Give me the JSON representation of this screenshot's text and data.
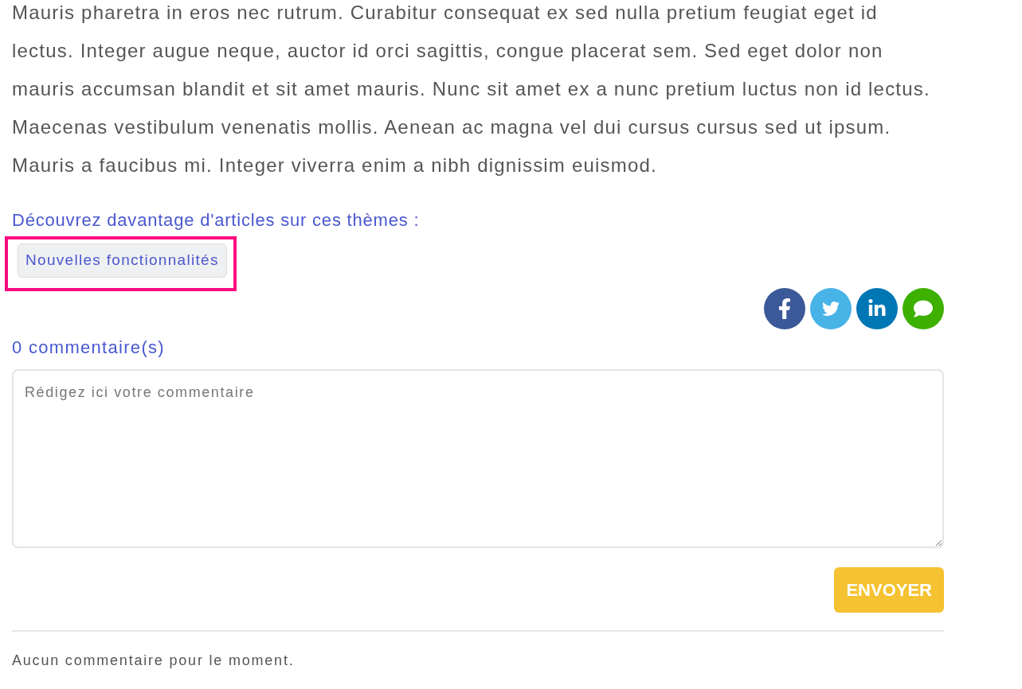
{
  "article": {
    "paragraph": "Mauris pharetra in eros nec rutrum. Curabitur consequat ex sed nulla pretium feugiat eget id lectus. Integer augue neque, auctor id orci sagittis, congue placerat sem. Sed eget dolor non mauris accumsan blandit et sit amet mauris. Nunc sit amet ex a nunc pretium luctus non id lectus. Maecenas vestibulum venenatis mollis. Aenean ac magna vel dui cursus cursus sed ut ipsum. Mauris a faucibus mi. Integer viverra enim a nibh dignissim euismod."
  },
  "topics": {
    "heading": "Découvrez davantage d'articles sur ces thèmes :",
    "tags": [
      {
        "label": "Nouvelles fonctionnalités",
        "highlighted": true
      }
    ]
  },
  "share_buttons": [
    {
      "kind": "facebook",
      "color": "#3b5998"
    },
    {
      "kind": "twitter",
      "color": "#48b3e6"
    },
    {
      "kind": "linkedin",
      "color": "#0077b5"
    },
    {
      "kind": "message",
      "color": "#3db000"
    }
  ],
  "comments": {
    "count_label": "0 commentaire(s)",
    "textarea": {
      "placeholder": "Rédigez ici votre commentaire"
    },
    "submit_button": "ENVOYER",
    "empty_message": "Aucun commentaire pour le moment."
  }
}
